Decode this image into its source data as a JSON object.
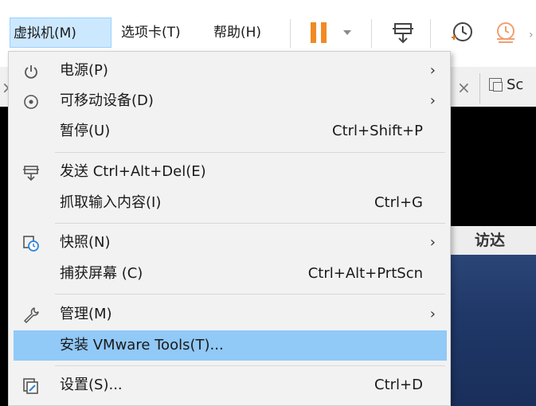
{
  "menubar": {
    "items": [
      {
        "label": "虚拟机(M)",
        "active": true
      },
      {
        "label": "选项卡(T)"
      },
      {
        "label": "帮助(H)"
      }
    ]
  },
  "tabs": {
    "partial_label": "Sc"
  },
  "desktop": {
    "finder_label": "访达"
  },
  "menu": {
    "items": [
      {
        "label": "电源(P)",
        "icon": "power-icon",
        "submenu": true
      },
      {
        "label": "可移动设备(D)",
        "icon": "removable-device-icon",
        "submenu": true
      },
      {
        "label": "暂停(U)",
        "shortcut": "Ctrl+Shift+P"
      },
      {
        "label": "发送 Ctrl+Alt+Del(E)",
        "icon": "send-keys-icon"
      },
      {
        "label": "抓取输入内容(I)",
        "shortcut": "Ctrl+G"
      },
      {
        "label": "快照(N)",
        "icon": "snapshot-icon",
        "submenu": true
      },
      {
        "label": "捕获屏幕 (C)",
        "shortcut": "Ctrl+Alt+PrtScn"
      },
      {
        "label": "管理(M)",
        "icon": "wrench-icon",
        "submenu": true
      },
      {
        "label": "安装 VMware Tools(T)...",
        "highlighted": true
      },
      {
        "label": "设置(S)...",
        "icon": "settings-icon",
        "shortcut": "Ctrl+D"
      }
    ],
    "submenu_arrow": "›"
  },
  "colors": {
    "highlight": "#91c9f7",
    "pause_orange": "#f08a24",
    "menubar_active": "#cce8ff"
  }
}
